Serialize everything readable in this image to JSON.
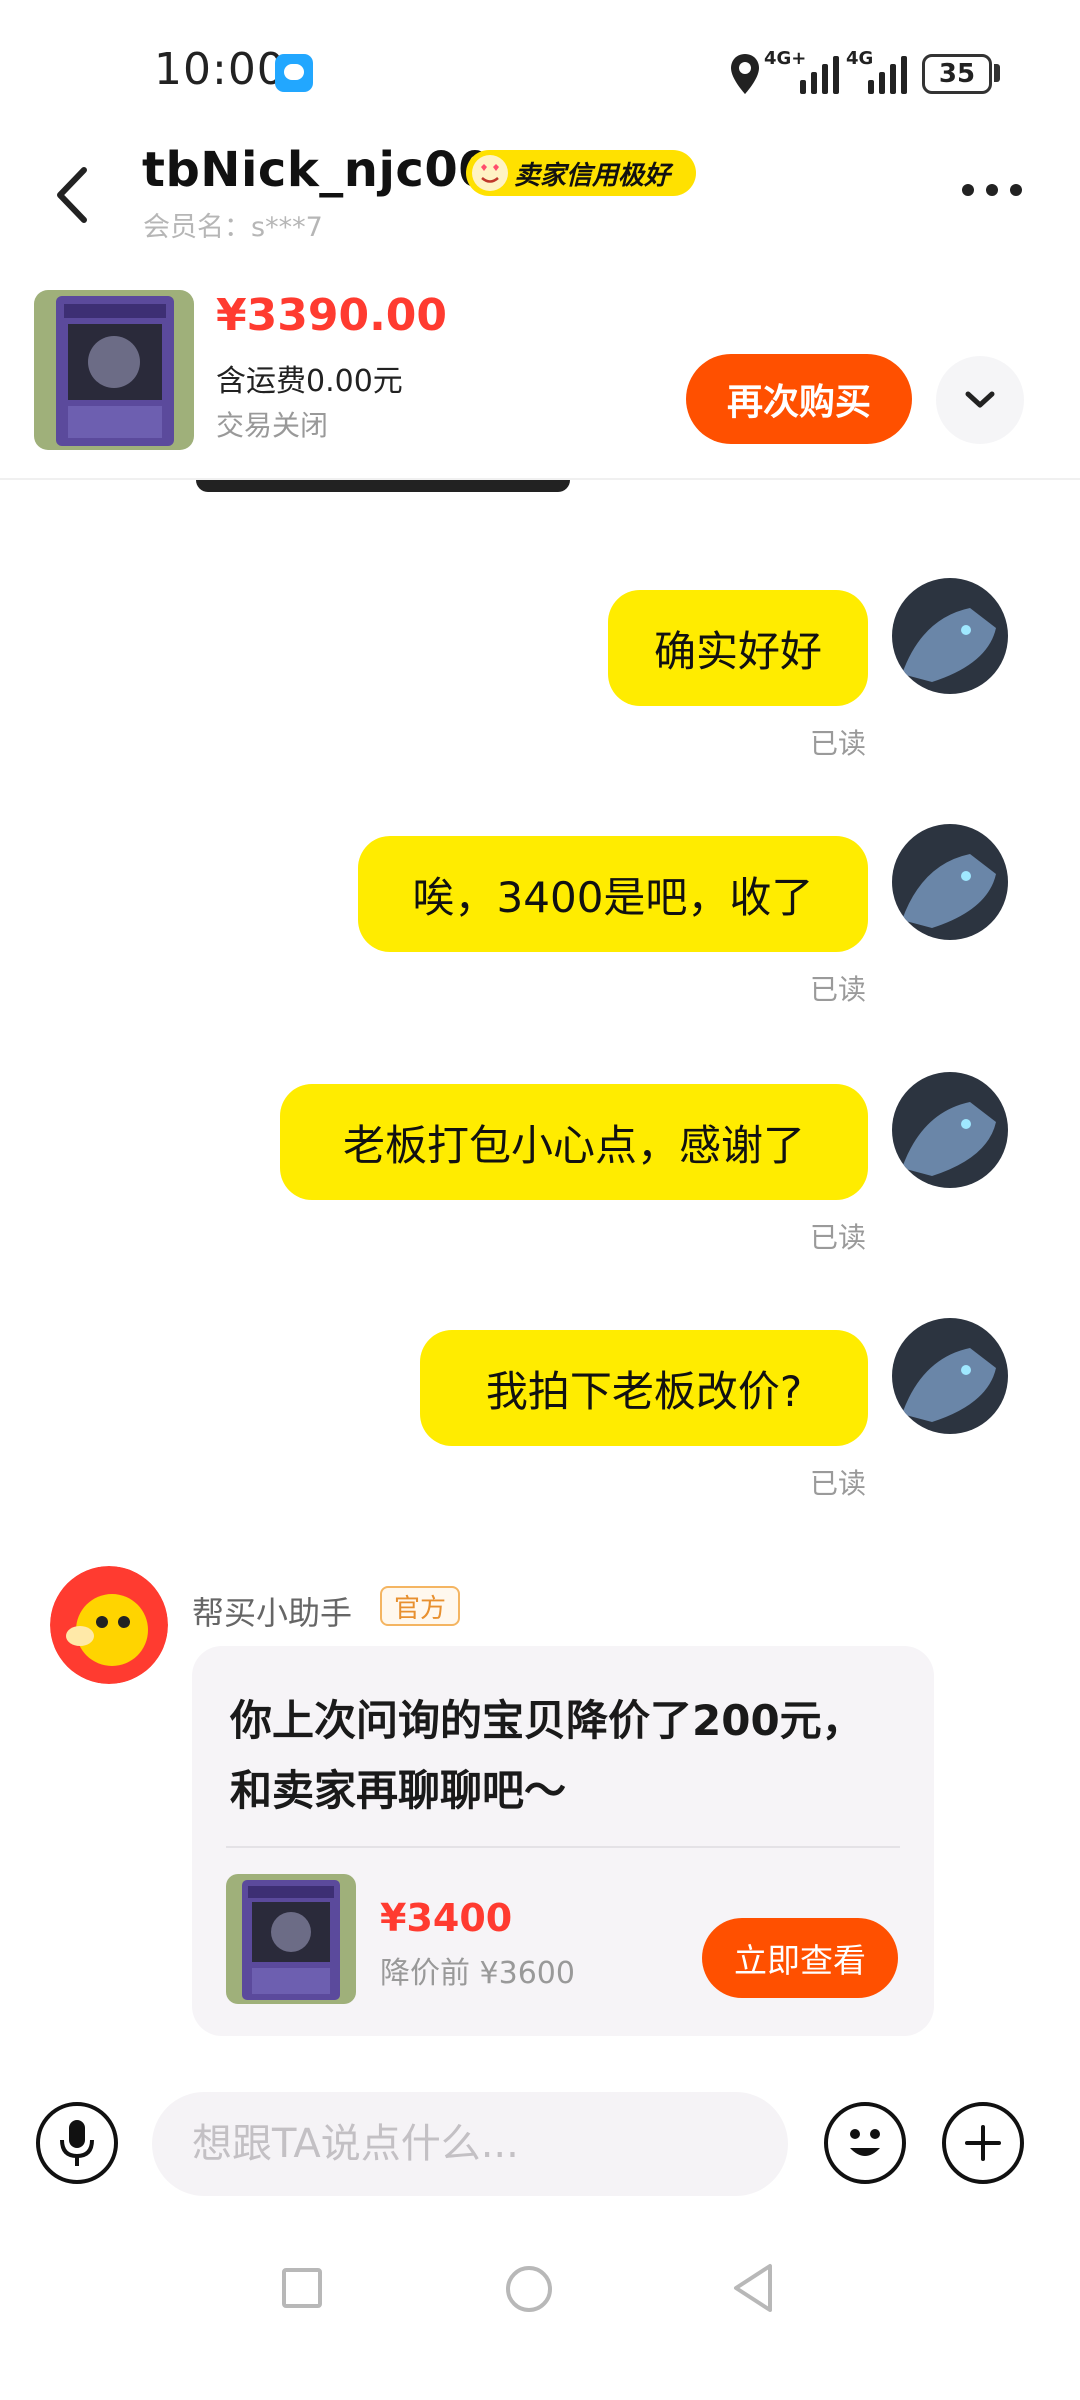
{
  "status_bar": {
    "time": "10:00",
    "network_1": "4G+",
    "network_2": "4G",
    "battery": "35",
    "icons": [
      "message-icon",
      "location-icon",
      "signal-icon",
      "battery-icon"
    ]
  },
  "header": {
    "seller_name": "tbNick_njc00",
    "credit_badge": "卖家信用极好",
    "member_label": "会员名：s***7",
    "icons": [
      "back-icon",
      "more-icon"
    ]
  },
  "product": {
    "price": "¥3390.00",
    "shipping": "含运费0.00元",
    "status": "交易关闭",
    "rebuy_label": "再次购买",
    "expand_icon": "chevron-down-icon"
  },
  "messages": [
    {
      "text": "确实好好",
      "read": "已读"
    },
    {
      "text": "唉，3400是吧，收了",
      "read": "已读"
    },
    {
      "text": "老板打包小心点，感谢了",
      "read": "已读"
    },
    {
      "text": "我拍下老板改价?",
      "read": "已读"
    }
  ],
  "assistant": {
    "name": "帮买小助手",
    "badge": "官方",
    "message": "你上次问询的宝贝降价了200元，和卖家再聊聊吧～",
    "price": "¥3400",
    "old_price": "降价前 ¥3600",
    "view_label": "立即查看"
  },
  "input_bar": {
    "placeholder": "想跟TA说点什么...",
    "icons": [
      "microphone-icon",
      "emoji-icon",
      "plus-icon"
    ]
  },
  "nav_bar": {
    "icons": [
      "recents-icon",
      "home-icon",
      "back-nav-icon"
    ]
  },
  "colors": {
    "accent_orange": "#ff5000",
    "bubble_yellow": "#ffec00",
    "price_red": "#ff3b30",
    "badge_yellow": "#ffe100"
  }
}
